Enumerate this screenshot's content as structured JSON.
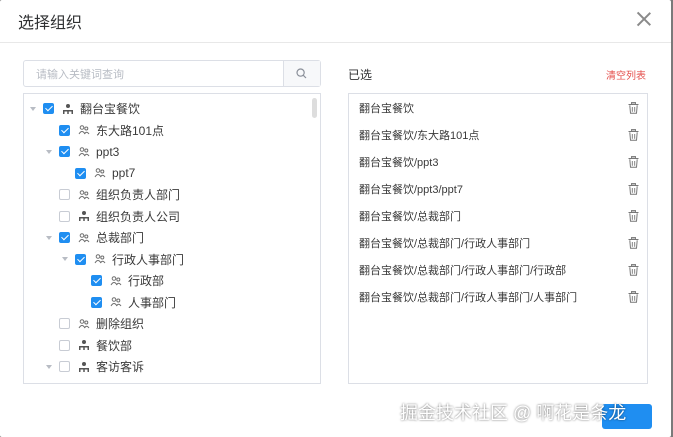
{
  "dialog": {
    "title": "选择组织"
  },
  "search": {
    "placeholder": "请输入关键词查询"
  },
  "tree": {
    "nodes": [
      {
        "label": "翻台宝餐饮",
        "checked": true,
        "expandable": true,
        "icon": "org-tree-icon"
      },
      {
        "label": "东大路101点",
        "checked": true,
        "expandable": false,
        "icon": "people-icon"
      },
      {
        "label": "ppt3",
        "checked": true,
        "expandable": true,
        "icon": "people-icon"
      },
      {
        "label": "ppt7",
        "checked": true,
        "expandable": false,
        "icon": "people-icon"
      },
      {
        "label": "组织负责人部门",
        "checked": false,
        "expandable": false,
        "icon": "people-icon"
      },
      {
        "label": "组织负责人公司",
        "checked": false,
        "expandable": false,
        "icon": "org-tree-icon"
      },
      {
        "label": "总裁部门",
        "checked": true,
        "expandable": true,
        "icon": "people-icon"
      },
      {
        "label": "行政人事部门",
        "checked": true,
        "expandable": true,
        "icon": "people-icon"
      },
      {
        "label": "行政部",
        "checked": true,
        "expandable": false,
        "icon": "people-icon"
      },
      {
        "label": "人事部门",
        "checked": true,
        "expandable": false,
        "icon": "people-icon"
      },
      {
        "label": "删除组织",
        "checked": false,
        "expandable": false,
        "icon": "people-icon"
      },
      {
        "label": "餐饮部",
        "checked": false,
        "expandable": false,
        "icon": "org-tree-icon"
      },
      {
        "label": "客访客诉",
        "checked": false,
        "expandable": true,
        "icon": "org-tree-icon"
      }
    ]
  },
  "selected": {
    "label": "已选",
    "clear_label": "清空列表",
    "items": [
      "翻台宝餐饮",
      "翻台宝餐饮/东大路101点",
      "翻台宝餐饮/ppt3",
      "翻台宝餐饮/ppt3/ppt7",
      "翻台宝餐饮/总裁部门",
      "翻台宝餐饮/总裁部门/行政人事部门",
      "翻台宝餐饮/总裁部门/行政人事部门/行政部",
      "翻台宝餐饮/总裁部门/行政人事部门/人事部门"
    ]
  },
  "watermark": "掘金技术社区 @ 啊花是条龙",
  "colors": {
    "accent": "#1f8ef1",
    "danger": "#e5504d"
  }
}
